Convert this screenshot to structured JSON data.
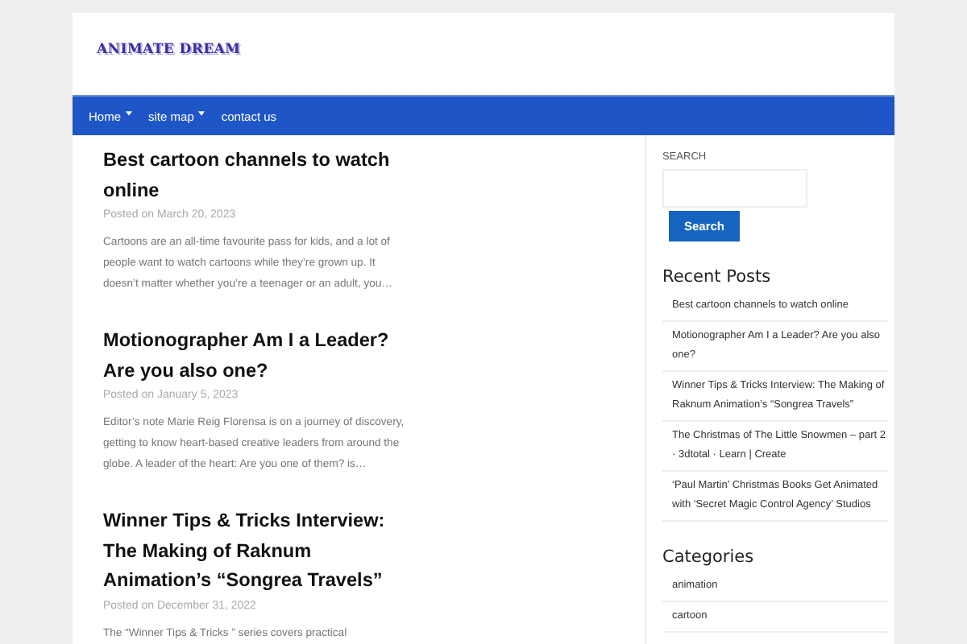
{
  "site": {
    "logo": "ANIMATE DREAM"
  },
  "nav": [
    {
      "label": "Home",
      "dropdown": true
    },
    {
      "label": "site map",
      "dropdown": true
    },
    {
      "label": "contact us",
      "dropdown": false
    }
  ],
  "posts": [
    {
      "title": "Best cartoon channels to watch online",
      "date": "Posted on March 20, 2023",
      "excerpt": "Cartoons are an all-time favourite pass for kids, and a lot of people want to watch cartoons while they’re grown up. It doesn’t matter whether you’re a teenager or an adult, you…"
    },
    {
      "title": "Motionographer Am I a Leader? Are you also one?",
      "date": "Posted on January 5, 2023",
      "excerpt": "Editor’s note Marie Reig Florensa is on a journey of discovery, getting to know heart-based creative leaders from around the globe.  A leader of the heart: Are you one of them? is…"
    },
    {
      "title": "Winner Tips & Tricks Interview: The Making of Raknum Animation’s “Songrea Travels”",
      "date": "Posted on December 31, 2022",
      "excerpt": "The “Winner Tips & Tricks ” series covers practical"
    }
  ],
  "sidebar": {
    "search_label": "SEARCH",
    "search_button": "Search",
    "recent_title": "Recent Posts",
    "recent": [
      "Best cartoon channels to watch online",
      "Motionographer Am I a Leader? Are you also one?",
      "Winner Tips & Tricks Interview: The Making of Raknum Animation’s “Songrea Travels”",
      "The Christmas of The Little Snowmen – part 2 · 3dtotal · Learn | Create",
      "‘Paul Martin’ Christmas Books Get Animated with ‘Secret Magic Control Agency’ Studios"
    ],
    "categories_title": "Categories",
    "categories": [
      "animation",
      "cartoon"
    ]
  }
}
